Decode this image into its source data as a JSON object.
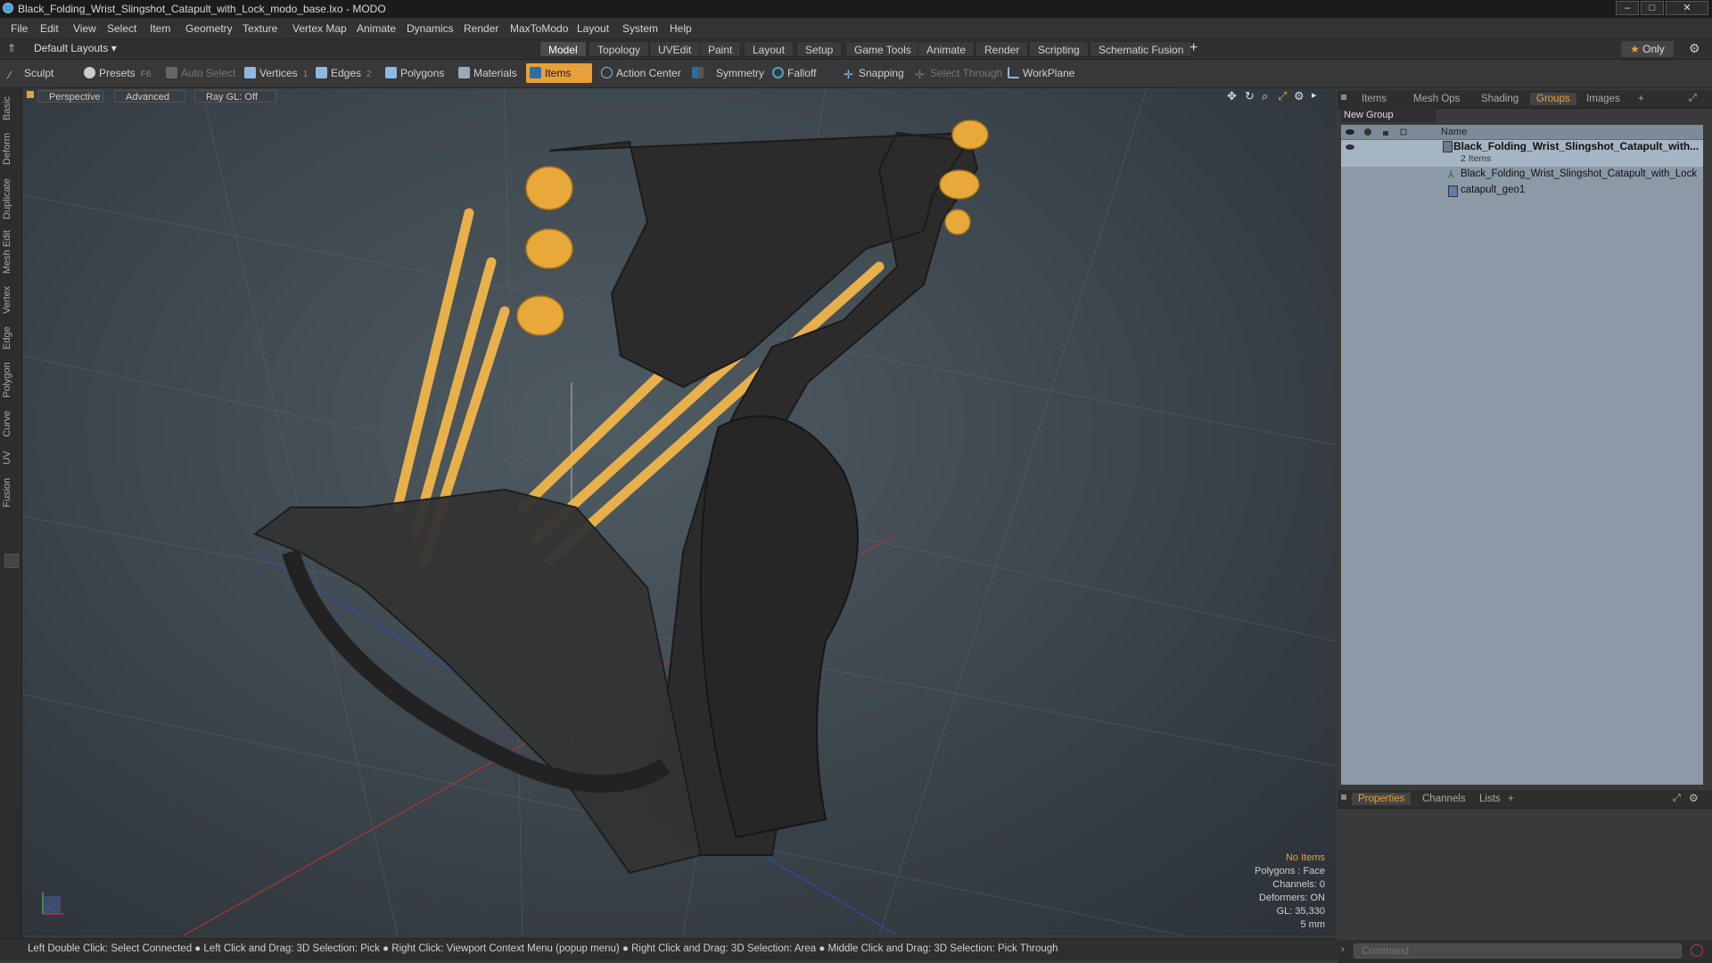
{
  "window": {
    "title": "Black_Folding_Wrist_Slingshot_Catapult_with_Lock_modo_base.lxo - MODO"
  },
  "menu": [
    "File",
    "Edit",
    "View",
    "Select",
    "Item",
    "Geometry",
    "Texture",
    "Vertex Map",
    "Animate",
    "Dynamics",
    "Render",
    "MaxToModo",
    "Layout",
    "System",
    "Help"
  ],
  "layout": {
    "preset": "Default Layouts ▾",
    "tabs": [
      "Model",
      "Topology",
      "UVEdit",
      "Paint",
      "Layout",
      "Setup",
      "Game Tools",
      "Animate",
      "Render",
      "Scripting",
      "Schematic Fusion"
    ],
    "active_tab": "Model",
    "add": "+",
    "only": "Only"
  },
  "toolbar": {
    "sculpt": "Sculpt",
    "presets": "Presets",
    "presets_key": "F6",
    "auto_select": "Auto Select",
    "vertices": "Vertices",
    "vertices_count": "1",
    "edges": "Edges",
    "edges_count": "2",
    "polygons": "Polygons",
    "materials": "Materials",
    "items": "Items",
    "action_center": "Action Center",
    "symmetry": "Symmetry",
    "falloff": "Falloff",
    "snapping": "Snapping",
    "select_through": "Select Through",
    "workplane": "WorkPlane"
  },
  "left_tabs": [
    "Basic",
    "Deform",
    "Duplicate",
    "Mesh Edit",
    "Vertex",
    "Edge",
    "Polygon",
    "Curve",
    "UV",
    "Fusion"
  ],
  "viewport": {
    "perspective": "Perspective",
    "advanced": "Advanced",
    "raygl": "Ray GL: Off",
    "info": {
      "no_items": "No Items",
      "polygons": "Polygons : Face",
      "channels": "Channels: 0",
      "deformers": "Deformers: ON",
      "gl": "GL: 35,330",
      "scale": "5 mm"
    }
  },
  "status": "Left Double Click: Select Connected ● Left Click and Drag: 3D Selection: Pick ● Right Click: Viewport Context Menu (popup menu) ● Right Click and Drag: 3D Selection: Area ● Middle Click and Drag: 3D Selection: Pick Through",
  "right_panel": {
    "tabs": [
      "Items",
      "Mesh Ops",
      "Shading",
      "Groups",
      "Images"
    ],
    "active_tab": "Groups",
    "new_group": "New Group",
    "name_col": "Name",
    "tree": {
      "group_name": "Black_Folding_Wrist_Slingshot_Catapult_with...",
      "group_count": "2 Items",
      "child1": "Black_Folding_Wrist_Slingshot_Catapult_with_Lock",
      "child2": "catapult_geo1"
    },
    "bottom_tabs": [
      "Properties",
      "Channels",
      "Lists"
    ],
    "bottom_active": "Properties",
    "command_placeholder": "Command"
  },
  "colors": {
    "accent": "#e8a03a",
    "bands": "#e8b04a",
    "frame": "#2b2b2b"
  }
}
